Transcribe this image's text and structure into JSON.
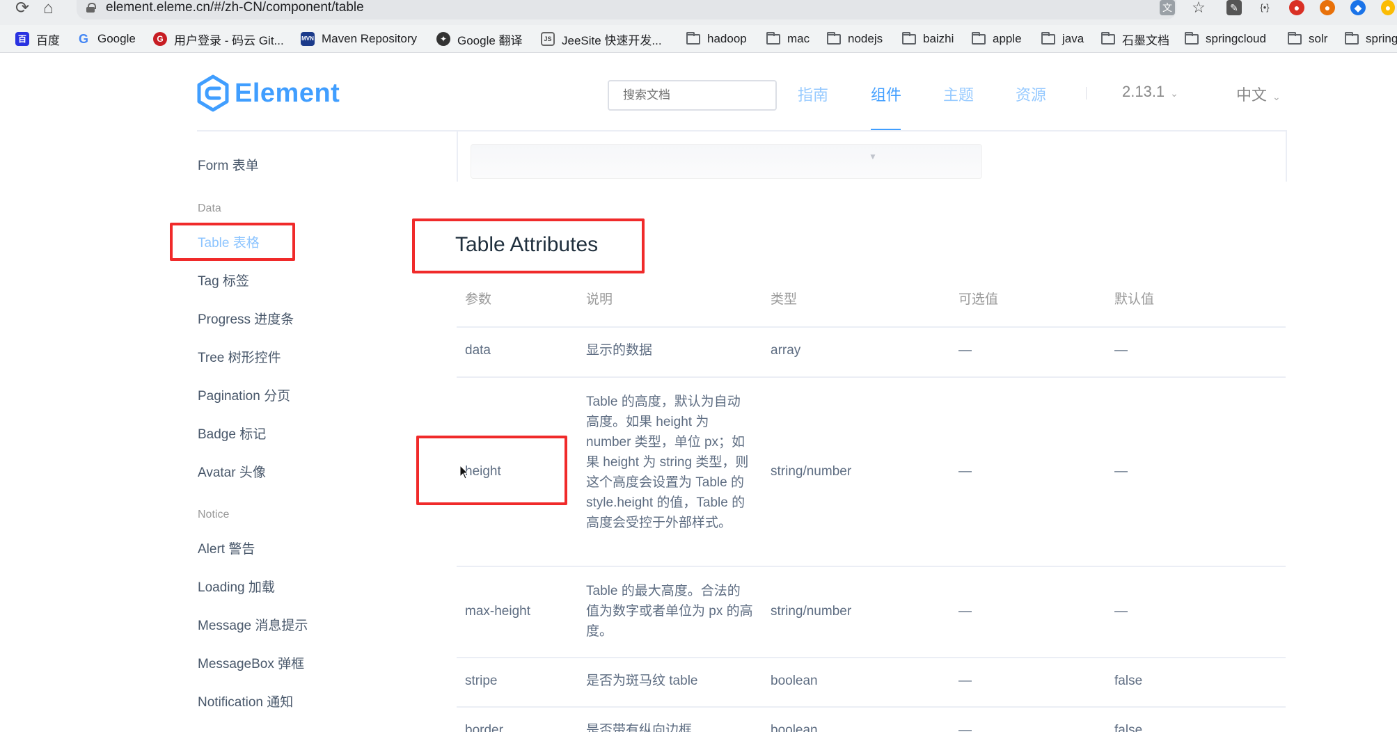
{
  "browser": {
    "url": "element.eleme.cn/#/zh-CN/component/table",
    "bookmarks": [
      {
        "label": "百度",
        "icon": "baidu-icon"
      },
      {
        "label": "Google",
        "icon": "google-icon"
      },
      {
        "label": "用户登录 - 码云 Git...",
        "icon": "gitee-icon"
      },
      {
        "label": "Maven Repository",
        "icon": "maven-icon"
      },
      {
        "label": "Google 翻译",
        "icon": "google-translate-icon"
      },
      {
        "label": "JeeSite 快速开发...",
        "icon": "jeesite-icon"
      },
      {
        "label": "hadoop",
        "icon": "folder-icon"
      },
      {
        "label": "mac",
        "icon": "folder-icon"
      },
      {
        "label": "nodejs",
        "icon": "folder-icon"
      },
      {
        "label": "baizhi",
        "icon": "folder-icon"
      },
      {
        "label": "apple",
        "icon": "folder-icon"
      },
      {
        "label": "java",
        "icon": "folder-icon"
      },
      {
        "label": "石墨文档",
        "icon": "folder-icon"
      },
      {
        "label": "springcloud",
        "icon": "folder-icon"
      },
      {
        "label": "solr",
        "icon": "folder-icon"
      },
      {
        "label": "spring",
        "icon": "folder-icon"
      }
    ]
  },
  "header": {
    "brand": "Element",
    "search_placeholder": "搜索文档",
    "nav": [
      "指南",
      "组件",
      "主题",
      "资源"
    ],
    "version": "2.13.1",
    "language": "中文"
  },
  "sidebar": {
    "top_item": "Form 表单",
    "group_data": "Data",
    "data_items": [
      "Table 表格",
      "Tag 标签",
      "Progress 进度条",
      "Tree 树形控件",
      "Pagination 分页",
      "Badge 标记",
      "Avatar 头像"
    ],
    "group_notice": "Notice",
    "notice_items": [
      "Alert 警告",
      "Loading 加载",
      "Message 消息提示",
      "MessageBox 弹框",
      "Notification 通知"
    ]
  },
  "content": {
    "section_title": "Table Attributes",
    "columns": [
      "参数",
      "说明",
      "类型",
      "可选值",
      "默认值"
    ],
    "rows": [
      {
        "param": "data",
        "desc": "显示的数据",
        "type": "array",
        "options": "—",
        "default": "—"
      },
      {
        "param": "height",
        "desc": "Table 的高度，默认为自动高度。如果 height 为 number 类型，单位 px；如果 height 为 string 类型，则这个高度会设置为 Table 的 style.height 的值，Table 的高度会受控于外部样式。",
        "type": "string/number",
        "options": "—",
        "default": "—"
      },
      {
        "param": "max-height",
        "desc": "Table 的最大高度。合法的值为数字或者单位为 px 的高度。",
        "type": "string/number",
        "options": "—",
        "default": "—"
      },
      {
        "param": "stripe",
        "desc": "是否为斑马纹 table",
        "type": "boolean",
        "options": "—",
        "default": "false"
      },
      {
        "param": "border",
        "desc": "是否带有纵向边框",
        "type": "boolean",
        "options": "—",
        "default": "false"
      }
    ]
  },
  "colors": {
    "brand": "#409eff",
    "highlight": "#f02a2a",
    "text": "#5e6d82"
  }
}
